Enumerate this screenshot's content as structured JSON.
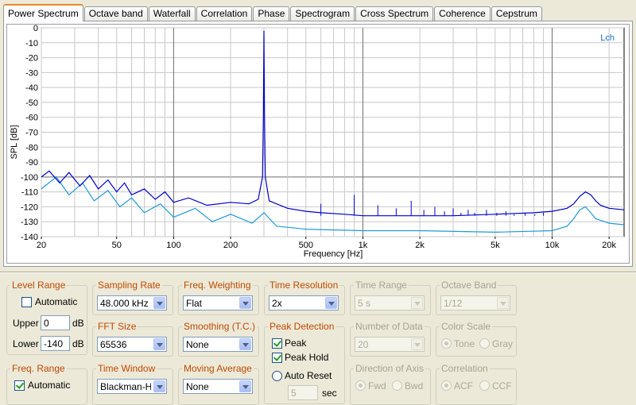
{
  "tabs": [
    "Power Spectrum",
    "Octave band",
    "Waterfall",
    "Correlation",
    "Phase",
    "Spectrogram",
    "Cross Spectrum",
    "Coherence",
    "Cepstrum"
  ],
  "active_tab": "Power Spectrum",
  "chart_data": {
    "type": "line",
    "ylabel": "SPL [dB]",
    "xlabel": "Frequency [Hz]",
    "x_scale": "log",
    "xlim": [
      20,
      24000
    ],
    "ylim": [
      -140,
      0
    ],
    "x_ticks": [
      {
        "v": 20,
        "l": "20"
      },
      {
        "v": 50,
        "l": "50"
      },
      {
        "v": 100,
        "l": "100"
      },
      {
        "v": 200,
        "l": "200"
      },
      {
        "v": 500,
        "l": "500"
      },
      {
        "v": 1000,
        "l": "1k"
      },
      {
        "v": 2000,
        "l": "2k"
      },
      {
        "v": 5000,
        "l": "5k"
      },
      {
        "v": 10000,
        "l": "10k"
      },
      {
        "v": 20000,
        "l": "20k"
      }
    ],
    "y_ticks": [
      0,
      -10,
      -20,
      -30,
      -40,
      -50,
      -60,
      -70,
      -80,
      -90,
      -100,
      -110,
      -120,
      -130,
      -140
    ],
    "channel_label": "Lch",
    "grid": true,
    "series": [
      {
        "color": "#0000cc",
        "points": [
          [
            20,
            -100
          ],
          [
            22,
            -96
          ],
          [
            25,
            -104
          ],
          [
            28,
            -97
          ],
          [
            32,
            -106
          ],
          [
            36,
            -99
          ],
          [
            40,
            -108
          ],
          [
            45,
            -102
          ],
          [
            50,
            -110
          ],
          [
            55,
            -104
          ],
          [
            60,
            -112
          ],
          [
            70,
            -108
          ],
          [
            80,
            -115
          ],
          [
            90,
            -110
          ],
          [
            100,
            -117
          ],
          [
            120,
            -114
          ],
          [
            150,
            -119
          ],
          [
            200,
            -117
          ],
          [
            250,
            -118
          ],
          [
            280,
            -115
          ],
          [
            295,
            -100
          ],
          [
            298,
            -60
          ],
          [
            300,
            -2
          ],
          [
            302,
            -60
          ],
          [
            305,
            -100
          ],
          [
            320,
            -116
          ],
          [
            400,
            -121
          ],
          [
            500,
            -123
          ],
          [
            600,
            -124
          ],
          [
            800,
            -125
          ],
          [
            1000,
            -126
          ],
          [
            1500,
            -126
          ],
          [
            2000,
            -126
          ],
          [
            3000,
            -126
          ],
          [
            5000,
            -125
          ],
          [
            8000,
            -124
          ],
          [
            10000,
            -123
          ],
          [
            12000,
            -121
          ],
          [
            13000,
            -118
          ],
          [
            14000,
            -113
          ],
          [
            15000,
            -110
          ],
          [
            16000,
            -112
          ],
          [
            17000,
            -116
          ],
          [
            18000,
            -119
          ],
          [
            20000,
            -121
          ],
          [
            24000,
            -122
          ]
        ]
      },
      {
        "color": "#1f9bd8",
        "points": [
          [
            20,
            -108
          ],
          [
            24,
            -100
          ],
          [
            28,
            -112
          ],
          [
            33,
            -104
          ],
          [
            38,
            -116
          ],
          [
            45,
            -109
          ],
          [
            52,
            -120
          ],
          [
            60,
            -114
          ],
          [
            70,
            -124
          ],
          [
            85,
            -118
          ],
          [
            100,
            -127
          ],
          [
            130,
            -121
          ],
          [
            160,
            -130
          ],
          [
            200,
            -125
          ],
          [
            260,
            -131
          ],
          [
            300,
            -124
          ],
          [
            350,
            -133
          ],
          [
            500,
            -135
          ],
          [
            1000,
            -136
          ],
          [
            2000,
            -136
          ],
          [
            5000,
            -137
          ],
          [
            10000,
            -136
          ],
          [
            12000,
            -133
          ],
          [
            13000,
            -128
          ],
          [
            14000,
            -122
          ],
          [
            15000,
            -120
          ],
          [
            16000,
            -124
          ],
          [
            17000,
            -128
          ],
          [
            20000,
            -131
          ],
          [
            24000,
            -132
          ]
        ]
      }
    ],
    "spikes": [
      [
        600,
        -118
      ],
      [
        900,
        -112
      ],
      [
        1200,
        -119
      ],
      [
        1500,
        -121
      ],
      [
        1800,
        -116
      ],
      [
        2100,
        -122
      ],
      [
        2400,
        -120
      ],
      [
        2700,
        -123
      ],
      [
        3000,
        -121
      ],
      [
        3300,
        -124
      ],
      [
        3600,
        -122
      ],
      [
        3900,
        -124
      ],
      [
        4500,
        -122
      ],
      [
        5100,
        -124
      ],
      [
        5700,
        -123
      ],
      [
        6300,
        -125
      ],
      [
        7200,
        -124
      ],
      [
        8100,
        -125
      ],
      [
        9000,
        -124
      ],
      [
        9900,
        -126
      ]
    ]
  },
  "controls": {
    "level_range": {
      "title": "Level Range",
      "automatic_label": "Automatic",
      "upper_label": "Upper",
      "upper_value": "0",
      "upper_unit": "dB",
      "lower_label": "Lower",
      "lower_value": "-140",
      "lower_unit": "dB"
    },
    "sampling_rate": {
      "title": "Sampling Rate",
      "value": "48.000 kHz"
    },
    "freq_weighting": {
      "title": "Freq. Weighting",
      "value": "Flat"
    },
    "time_resolution": {
      "title": "Time Resolution",
      "value": "2x"
    },
    "time_range": {
      "title": "Time Range",
      "value": "5 s"
    },
    "octave_band": {
      "title": "Octave Band",
      "value": "1/12"
    },
    "fft_size": {
      "title": "FFT Size",
      "value": "65536"
    },
    "smoothing": {
      "title": "Smoothing (T.C.)",
      "value": "None"
    },
    "peak_detection": {
      "title": "Peak Detection",
      "peak_label": "Peak",
      "peak_hold_label": "Peak Hold",
      "auto_reset_label": "Auto Reset",
      "reset_value": "5",
      "reset_unit": "sec"
    },
    "number_of_data": {
      "title": "Number of Data",
      "value": "20"
    },
    "color_scale": {
      "title": "Color Scale",
      "tone_label": "Tone",
      "gray_label": "Gray"
    },
    "freq_range": {
      "title": "Freq. Range",
      "automatic_label": "Automatic"
    },
    "time_window": {
      "title": "Time Window",
      "value": "Blackman-H"
    },
    "moving_average": {
      "title": "Moving Average",
      "value": "None"
    },
    "direction_of_axis": {
      "title": "Direction of Axis",
      "fwd_label": "Fwd",
      "bwd_label": "Bwd"
    },
    "correlation": {
      "title": "Correlation",
      "acf_label": "ACF",
      "ccf_label": "CCF"
    }
  }
}
